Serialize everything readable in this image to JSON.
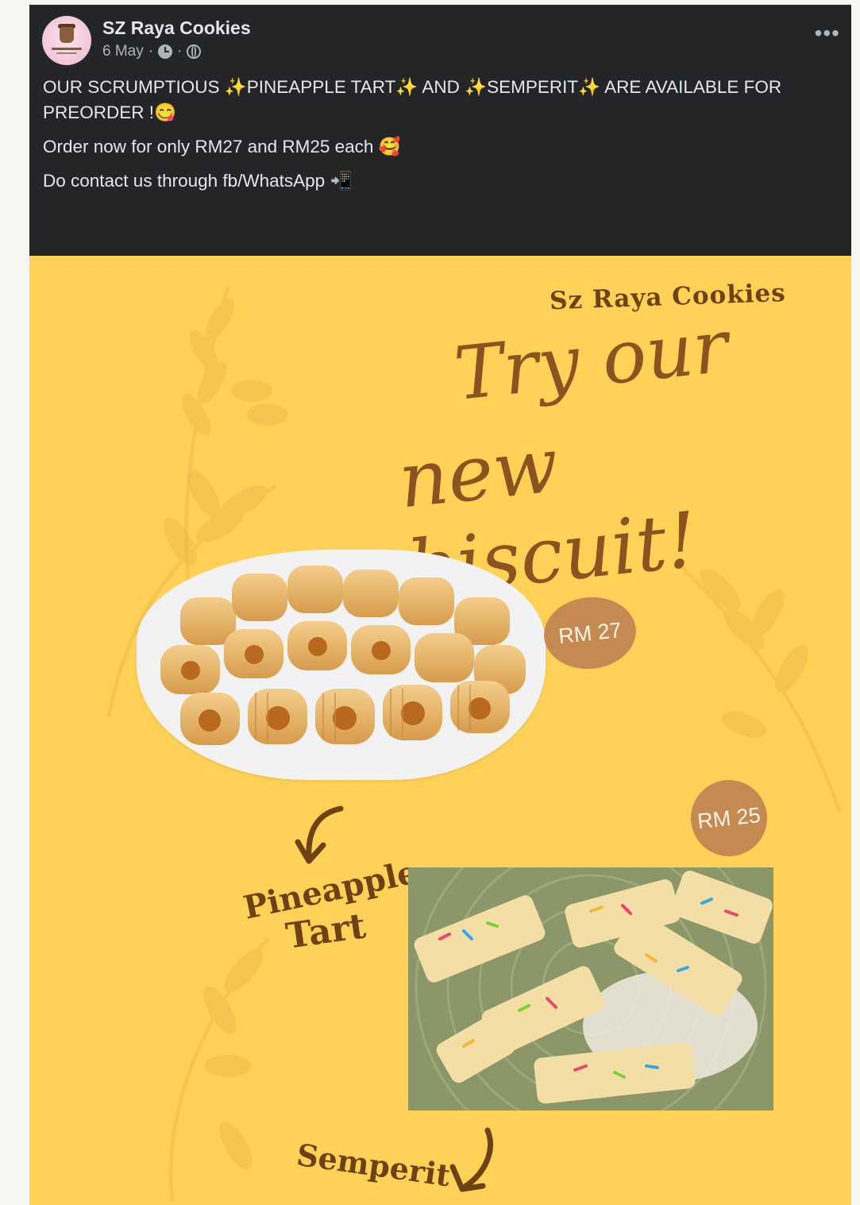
{
  "post": {
    "page_name": "SZ Raya Cookies",
    "date": "6 May",
    "separator": "·",
    "more_label": "•••",
    "text": {
      "line1": "OUR SCRUMPTIOUS ✨PINEAPPLE TART✨ AND ✨SEMPERIT✨ ARE AVAILABLE FOR PREORDER !😋",
      "line2": "Order now for only RM27 and RM25 each 🥰",
      "line3": "Do contact us through fb/WhatsApp 📲"
    }
  },
  "poster": {
    "brand": "Sz Raya Cookies",
    "headline_line1": "Try our",
    "headline_line2": "new biscuit!",
    "price_pineapple": "RM 27",
    "price_semperit": "RM 25",
    "label_pineapple": "Pineapple",
    "label_tart": "Tart",
    "label_semperit": "Semperit"
  },
  "colors": {
    "header_bg": "#242526",
    "poster_bg": "#ffd257",
    "accent_brown": "#8b5320",
    "badge": "#c48a52"
  },
  "icons": [
    "avatar-logo",
    "clock-icon",
    "globe-icon",
    "more-options-icon",
    "arrow-icon"
  ]
}
